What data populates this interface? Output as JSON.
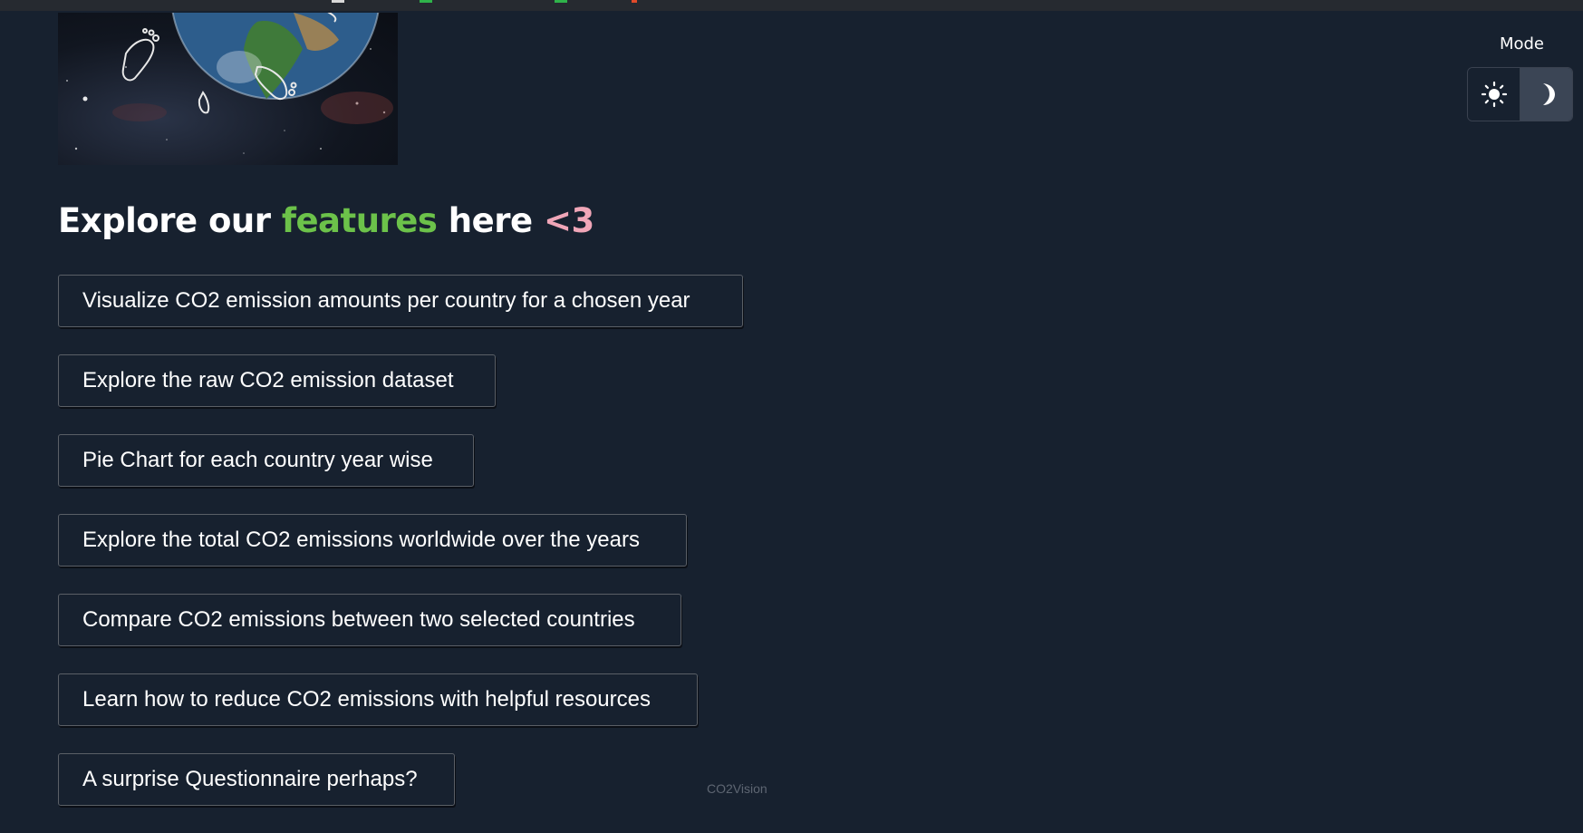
{
  "heading": {
    "part1": "Explore our ",
    "highlight": "features",
    "part2": " here ",
    "suffix": "<3"
  },
  "features": [
    "Visualize CO2 emission amounts per country for a chosen year",
    "Explore the raw CO2 emission dataset",
    "Pie Chart for each country year wise",
    "Explore the total CO2 emissions worldwide over the years",
    "Compare CO2 emissions between two selected countries",
    "Learn how to reduce CO2 emissions with helpful resources",
    "A surprise Questionnaire perhaps?"
  ],
  "mode": {
    "label": "Mode",
    "options": [
      "sun-icon",
      "moon-icon"
    ],
    "selected": "dark"
  },
  "footer": {
    "brand": "CO2Vision"
  },
  "colors": {
    "background": "#17212f",
    "highlight_green": "#6cc24a",
    "suffix_pink": "#f0a6b8",
    "toggle_active": "#3b4555"
  }
}
